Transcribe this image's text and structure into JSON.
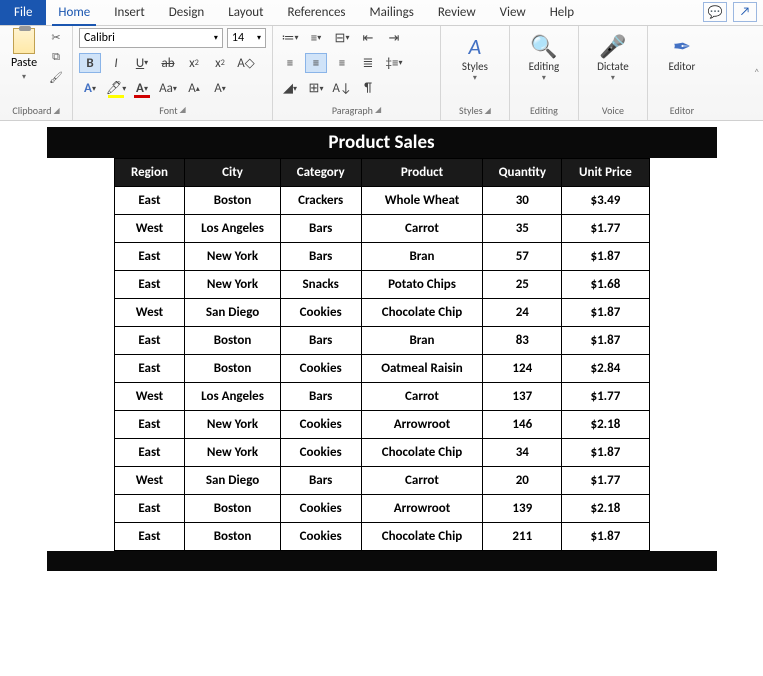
{
  "tabs": {
    "file": "File",
    "home": "Home",
    "insert": "Insert",
    "design": "Design",
    "layout": "Layout",
    "references": "References",
    "mailings": "Mailings",
    "review": "Review",
    "view": "View",
    "help": "Help"
  },
  "ribbon": {
    "clipboard": {
      "paste": "Paste",
      "label": "Clipboard"
    },
    "font": {
      "name": "Calibri",
      "size": "14",
      "label": "Font"
    },
    "paragraph": {
      "label": "Paragraph"
    },
    "styles": {
      "big": "Styles",
      "label": "Styles"
    },
    "editing": {
      "big": "Editing",
      "label": "Editing"
    },
    "dictate": {
      "big": "Dictate",
      "label": "Voice"
    },
    "editor": {
      "big": "Editor",
      "label": "Editor"
    }
  },
  "doc": {
    "title": "Product Sales",
    "headers": [
      "Region",
      "City",
      "Category",
      "Product",
      "Quantity",
      "Unit Price"
    ],
    "rows": [
      [
        "East",
        "Boston",
        "Crackers",
        "Whole Wheat",
        "30",
        "$3.49"
      ],
      [
        "West",
        "Los Angeles",
        "Bars",
        "Carrot",
        "35",
        "$1.77"
      ],
      [
        "East",
        "New York",
        "Bars",
        "Bran",
        "57",
        "$1.87"
      ],
      [
        "East",
        "New York",
        "Snacks",
        "Potato Chips",
        "25",
        "$1.68"
      ],
      [
        "West",
        "San Diego",
        "Cookies",
        "Chocolate Chip",
        "24",
        "$1.87"
      ],
      [
        "East",
        "Boston",
        "Bars",
        "Bran",
        "83",
        "$1.87"
      ],
      [
        "East",
        "Boston",
        "Cookies",
        "Oatmeal Raisin",
        "124",
        "$2.84"
      ],
      [
        "West",
        "Los Angeles",
        "Bars",
        "Carrot",
        "137",
        "$1.77"
      ],
      [
        "East",
        "New York",
        "Cookies",
        "Arrowroot",
        "146",
        "$2.18"
      ],
      [
        "East",
        "New York",
        "Cookies",
        "Chocolate Chip",
        "34",
        "$1.87"
      ],
      [
        "West",
        "San Diego",
        "Bars",
        "Carrot",
        "20",
        "$1.77"
      ],
      [
        "East",
        "Boston",
        "Cookies",
        "Arrowroot",
        "139",
        "$2.18"
      ],
      [
        "East",
        "Boston",
        "Cookies",
        "Chocolate Chip",
        "211",
        "$1.87"
      ]
    ]
  },
  "chart_data": {
    "type": "table",
    "title": "Product Sales",
    "columns": [
      "Region",
      "City",
      "Category",
      "Product",
      "Quantity",
      "Unit Price"
    ],
    "rows": [
      {
        "Region": "East",
        "City": "Boston",
        "Category": "Crackers",
        "Product": "Whole Wheat",
        "Quantity": 30,
        "Unit Price": 3.49
      },
      {
        "Region": "West",
        "City": "Los Angeles",
        "Category": "Bars",
        "Product": "Carrot",
        "Quantity": 35,
        "Unit Price": 1.77
      },
      {
        "Region": "East",
        "City": "New York",
        "Category": "Bars",
        "Product": "Bran",
        "Quantity": 57,
        "Unit Price": 1.87
      },
      {
        "Region": "East",
        "City": "New York",
        "Category": "Snacks",
        "Product": "Potato Chips",
        "Quantity": 25,
        "Unit Price": 1.68
      },
      {
        "Region": "West",
        "City": "San Diego",
        "Category": "Cookies",
        "Product": "Chocolate Chip",
        "Quantity": 24,
        "Unit Price": 1.87
      },
      {
        "Region": "East",
        "City": "Boston",
        "Category": "Bars",
        "Product": "Bran",
        "Quantity": 83,
        "Unit Price": 1.87
      },
      {
        "Region": "East",
        "City": "Boston",
        "Category": "Cookies",
        "Product": "Oatmeal Raisin",
        "Quantity": 124,
        "Unit Price": 2.84
      },
      {
        "Region": "West",
        "City": "Los Angeles",
        "Category": "Bars",
        "Product": "Carrot",
        "Quantity": 137,
        "Unit Price": 1.77
      },
      {
        "Region": "East",
        "City": "New York",
        "Category": "Cookies",
        "Product": "Arrowroot",
        "Quantity": 146,
        "Unit Price": 2.18
      },
      {
        "Region": "East",
        "City": "New York",
        "Category": "Cookies",
        "Product": "Chocolate Chip",
        "Quantity": 34,
        "Unit Price": 1.87
      },
      {
        "Region": "West",
        "City": "San Diego",
        "Category": "Bars",
        "Product": "Carrot",
        "Quantity": 20,
        "Unit Price": 1.77
      },
      {
        "Region": "East",
        "City": "Boston",
        "Category": "Cookies",
        "Product": "Arrowroot",
        "Quantity": 139,
        "Unit Price": 2.18
      },
      {
        "Region": "East",
        "City": "Boston",
        "Category": "Cookies",
        "Product": "Chocolate Chip",
        "Quantity": 211,
        "Unit Price": 1.87
      }
    ]
  }
}
